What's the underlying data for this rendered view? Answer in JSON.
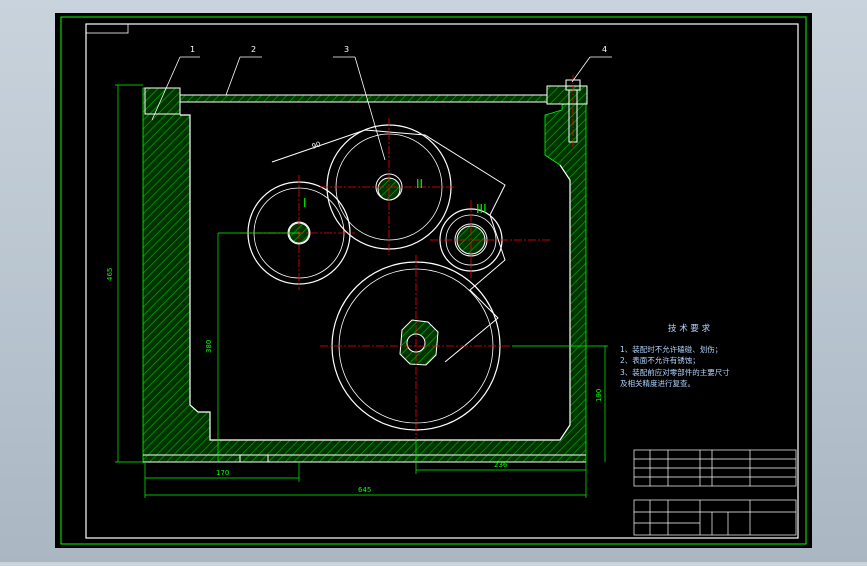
{
  "colors": {
    "background": "#000000",
    "frame": "#00ff00",
    "geometry": "#ffffff",
    "hatch": "#00aa00",
    "center_line": "#ff0000",
    "dimension": "#00ff00",
    "roman_numeral": "#00ff00",
    "notes": "#b0d4ff"
  },
  "callouts": [
    {
      "number": "1"
    },
    {
      "number": "2"
    },
    {
      "number": "3"
    },
    {
      "number": "4"
    }
  ],
  "shafts": [
    {
      "label": "I"
    },
    {
      "label": "II"
    },
    {
      "label": "III"
    }
  ],
  "dimensions": {
    "height_left": "465",
    "height_center": "380",
    "height_right": "190",
    "width_left": "170",
    "width_right": "236",
    "width_total": "645",
    "angle": "90"
  },
  "notes": {
    "title": "技 术 要 求",
    "lines": [
      "1、装配时不允许磕碰、划伤；",
      "2、表面不允许有锈蚀；",
      "3、装配前应对零部件的主要尺寸",
      "   及相关精度进行复查。"
    ]
  }
}
